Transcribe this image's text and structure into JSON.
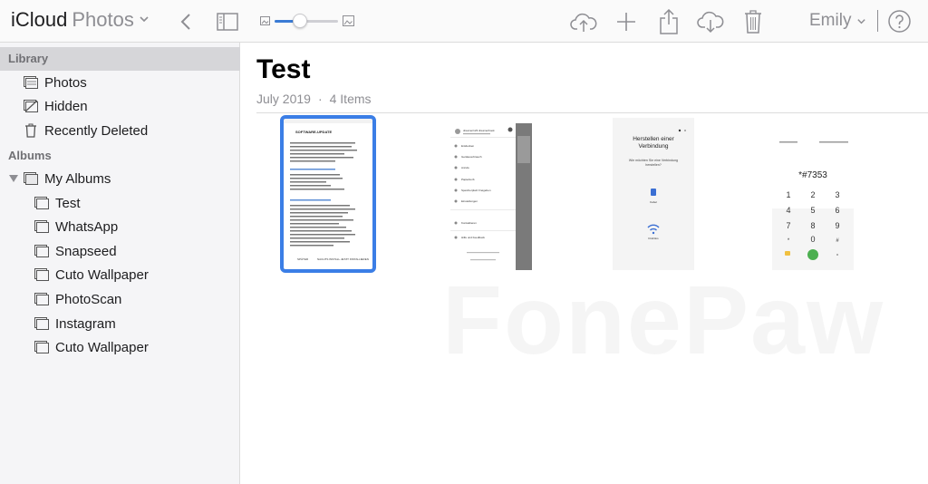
{
  "app": {
    "brand_primary": "iCloud",
    "brand_secondary": "Photos"
  },
  "toolbar": {
    "back_icon": "chevron-left-icon",
    "sidebar_toggle_icon": "sidebar-toggle-icon",
    "zoom": 0.4,
    "upload_icon": "cloud-upload-icon",
    "add_icon": "plus-icon",
    "share_icon": "share-icon",
    "download_icon": "cloud-download-icon",
    "delete_icon": "trash-icon",
    "help_icon": "help-icon",
    "accent_color": "#3b7ee6"
  },
  "user": {
    "name": "Emily"
  },
  "sidebar": {
    "library_header": "Library",
    "library_items": [
      {
        "label": "Photos",
        "icon": "photos-icon"
      },
      {
        "label": "Hidden",
        "icon": "hidden-icon"
      },
      {
        "label": "Recently Deleted",
        "icon": "trash-icon"
      }
    ],
    "albums_header": "Albums",
    "my_albums": {
      "label": "My Albums",
      "icon": "album-stack-icon"
    },
    "album_items": [
      {
        "label": "Test"
      },
      {
        "label": "WhatsApp"
      },
      {
        "label": "Snapseed"
      },
      {
        "label": "Cuto Wallpaper"
      },
      {
        "label": "PhotoScan"
      },
      {
        "label": "Instagram"
      },
      {
        "label": "Cuto Wallpaper"
      }
    ]
  },
  "album": {
    "title": "Test",
    "date": "July 2019",
    "separator": "·",
    "count": "4 Items"
  },
  "thumbnails": {
    "t1": {
      "heading": "SOFTWARE-UPDATE",
      "buttons": [
        "SPÄTER",
        "NACHTS INSTALL.",
        "JETZT INSTALLIEREN"
      ]
    },
    "t2": {
      "account": "dreamer123 dreamerbook",
      "menu": [
        "Entdecken",
        "Geräteverbrauch",
        "Anrufe",
        "Papierkorb",
        "Speicherplatz Freigeben",
        "Einstellungen",
        "Kontaktieren",
        "Hilfe und Feedback"
      ]
    },
    "t3": {
      "title": "Herstellen einer Verbindung",
      "subtitle": "Wie möchten Sie eine Verbindung herstellen?",
      "option1": "Kabel",
      "option2": "Drahtlos"
    },
    "t4": {
      "number": "*#7353",
      "keys": [
        "1",
        "2",
        "3",
        "4",
        "5",
        "6",
        "7",
        "8",
        "9",
        "*",
        "0",
        "#"
      ]
    }
  },
  "watermark": "FonePaw"
}
